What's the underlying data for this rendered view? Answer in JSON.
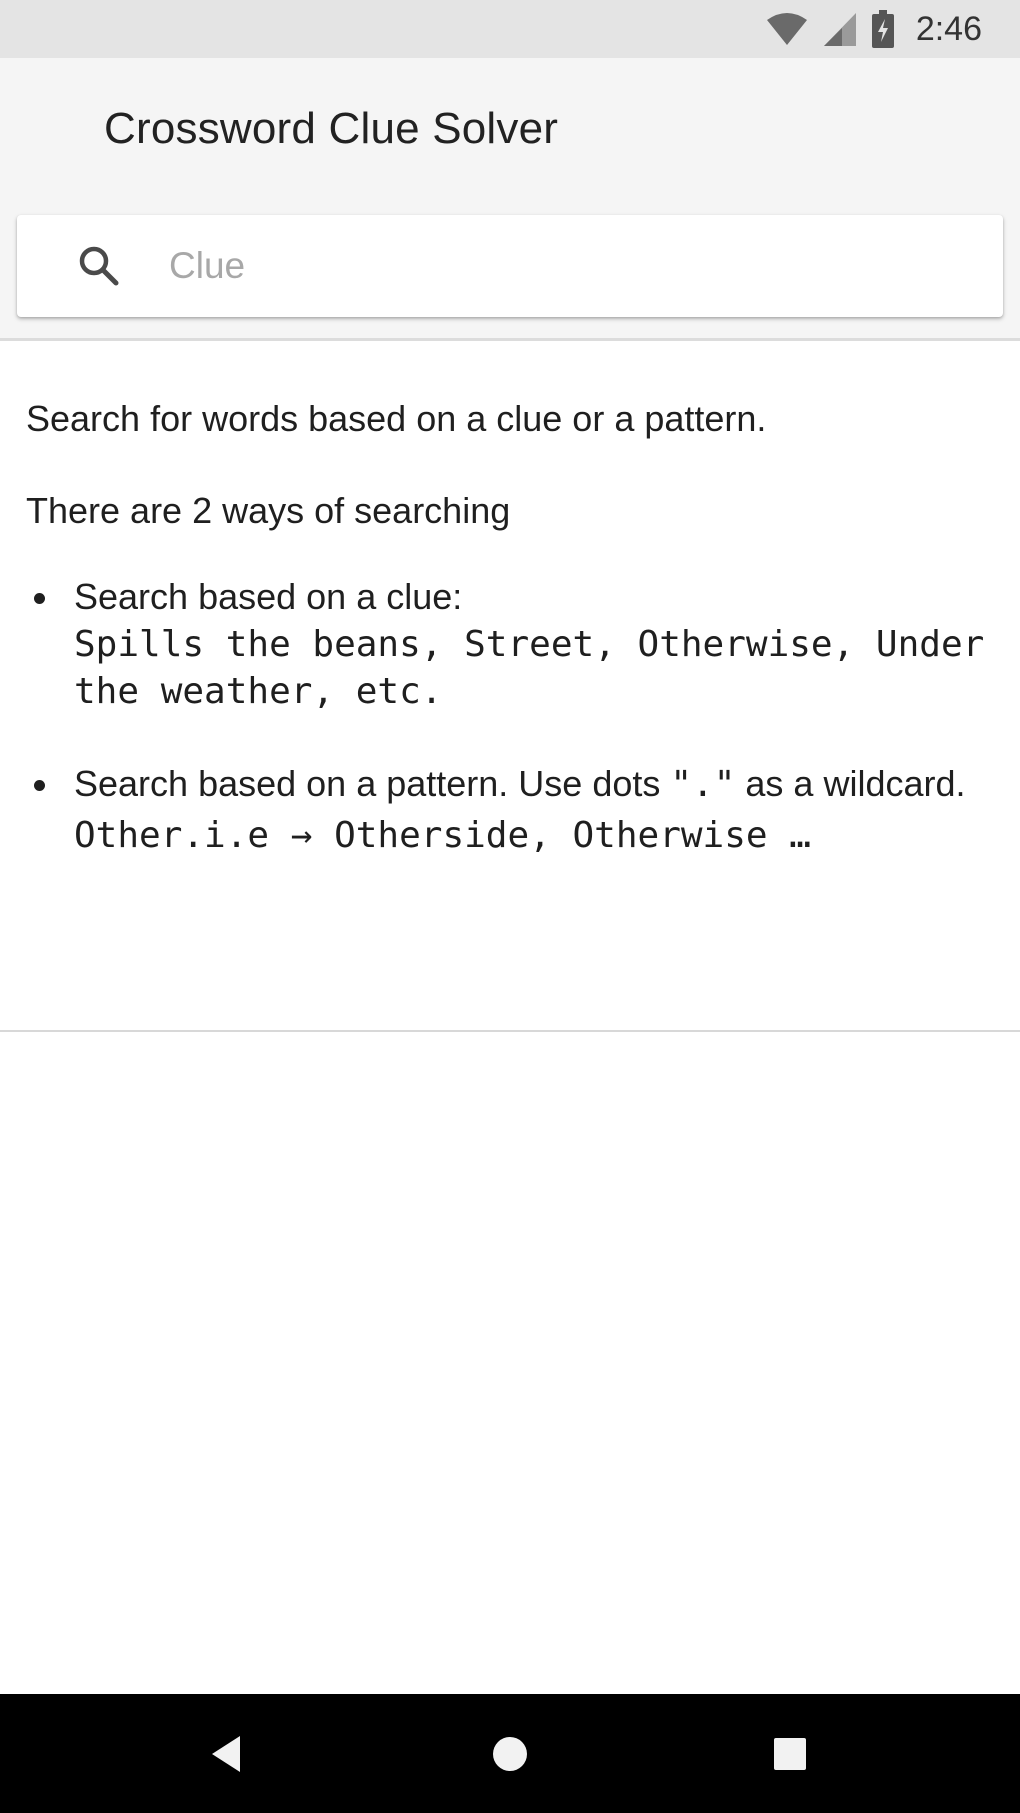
{
  "status_bar": {
    "time": "2:46",
    "icons": [
      "wifi-icon",
      "cellular-signal-icon",
      "battery-charging-icon"
    ]
  },
  "app_bar": {
    "title": "Crossword Clue Solver",
    "background": "#f5f5f5"
  },
  "search": {
    "placeholder": "Clue",
    "value": "",
    "icon": "search-icon"
  },
  "help": {
    "intro": "Search for words based on a clue or a pattern.",
    "ways_heading": "There are 2 ways of searching",
    "clue_item": {
      "label": "Search based on a clue:",
      "examples": "Spills the beans, Street, Otherwise, Under the weather, etc."
    },
    "pattern_item": {
      "label_before": "Search based on a pattern. Use dots ",
      "dot": "\".\"",
      "label_after": " as a wildcard.",
      "example": "Other.i.e → Otherside, Otherwise …"
    }
  },
  "nav_bar": {
    "buttons": [
      "back-icon",
      "home-icon",
      "recents-icon"
    ],
    "background": "#000000"
  }
}
